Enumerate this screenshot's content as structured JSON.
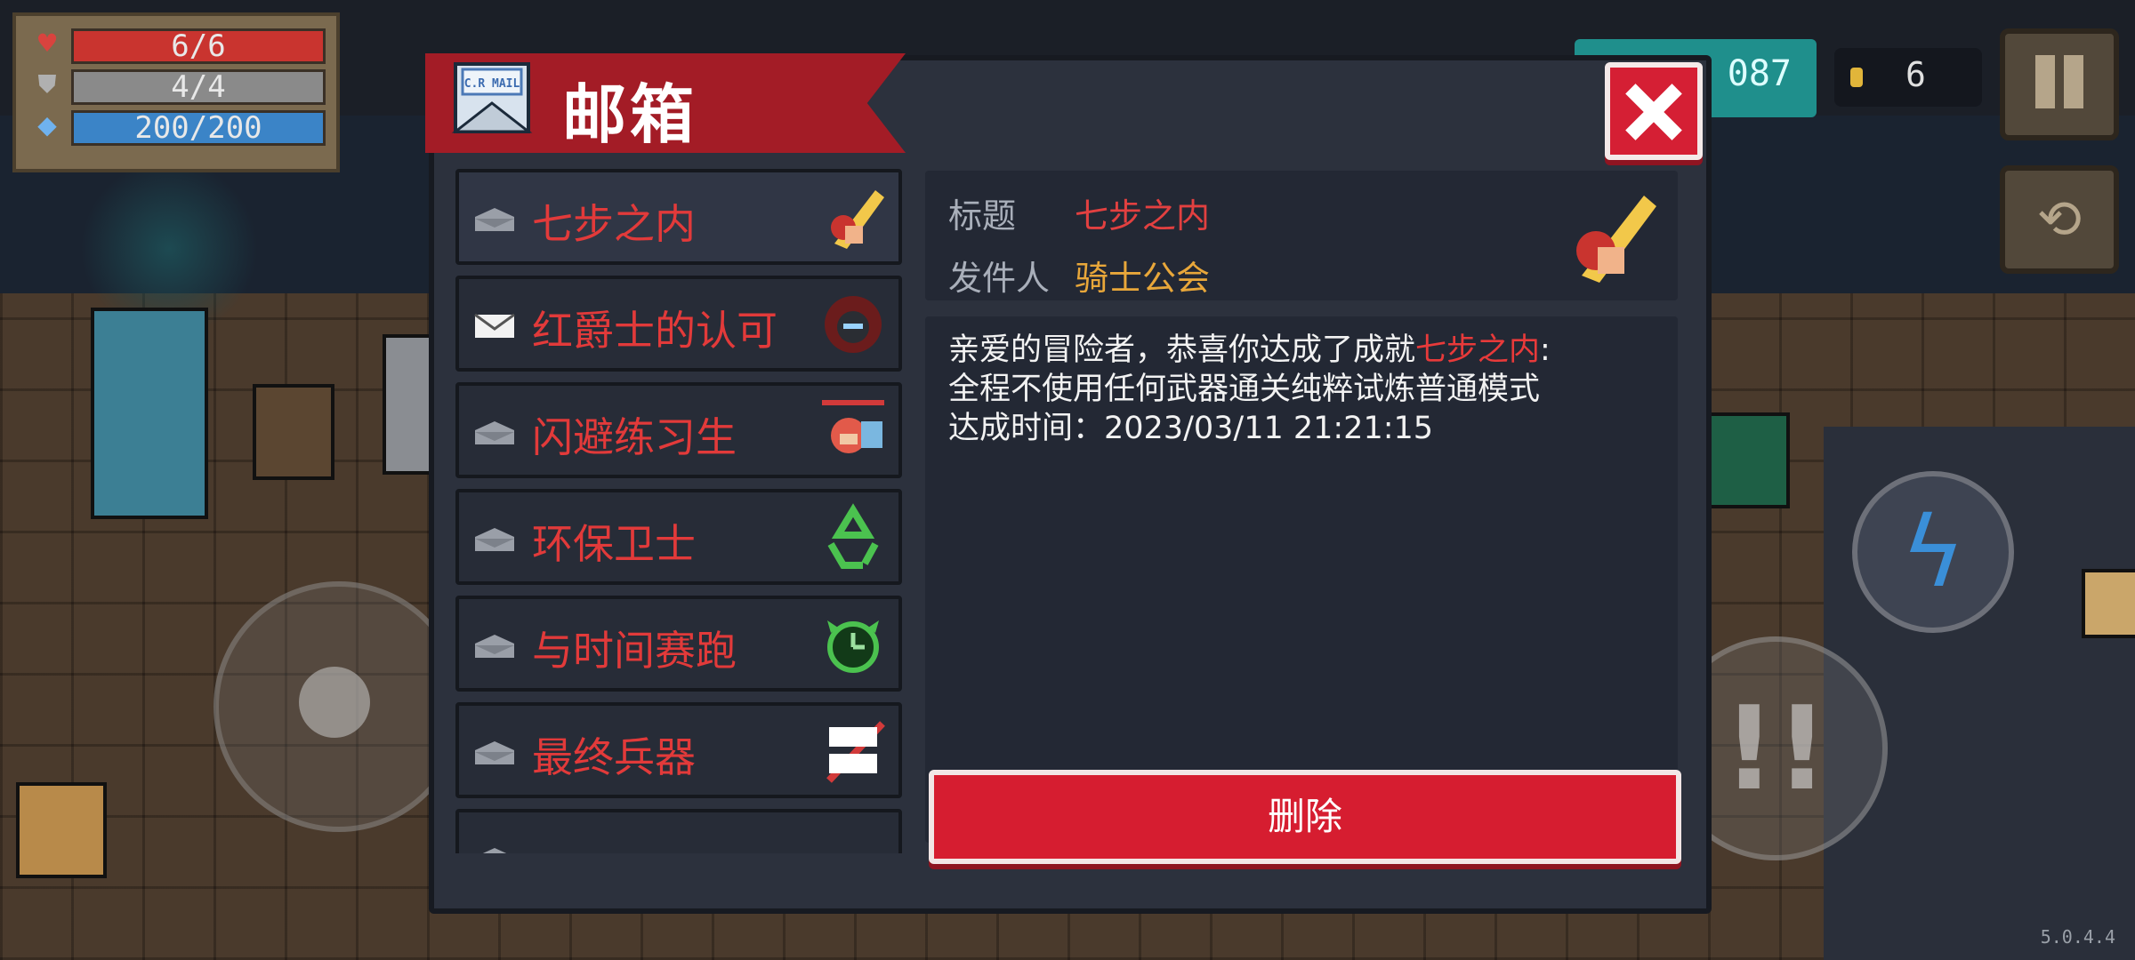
{
  "hud": {
    "hp": "6/6",
    "armor": "4/4",
    "energy": "200/200",
    "gems": "087",
    "coins": "6"
  },
  "dialog": {
    "title": "邮箱",
    "mail_icon_text": "C.R MAIL"
  },
  "mail_list": [
    {
      "label": "七步之内",
      "icon": "sword-burst-icon",
      "opened": true
    },
    {
      "label": "红爵士的认可",
      "icon": "red-knight-helmet-icon",
      "opened": false
    },
    {
      "label": "闪避练习生",
      "icon": "dodge-character-icon",
      "opened": true
    },
    {
      "label": "环保卫士",
      "icon": "recycle-icon",
      "opened": true
    },
    {
      "label": "与时间赛跑",
      "icon": "clock-icon",
      "opened": true
    },
    {
      "label": "最终兵器",
      "icon": "final-weapon-icon",
      "opened": true
    }
  ],
  "detail": {
    "title_label": "标题",
    "title_value": "七步之内",
    "sender_label": "发件人",
    "sender_value": "骑士公会",
    "body_prefix": "亲爱的冒险者，恭喜你达成了成就",
    "body_highlight": "七步之内",
    "body_colon": ":",
    "body_line2": "全程不使用任何武器通关纯粹试炼普通模式",
    "body_line3": "达成时间：2023/03/11 21:21:15"
  },
  "buttons": {
    "delete": "删除"
  },
  "version": "5.0.4.4",
  "colors": {
    "accent_red": "#d61d30",
    "text_red": "#e23a3a",
    "sender_gold": "#e8a73a"
  }
}
